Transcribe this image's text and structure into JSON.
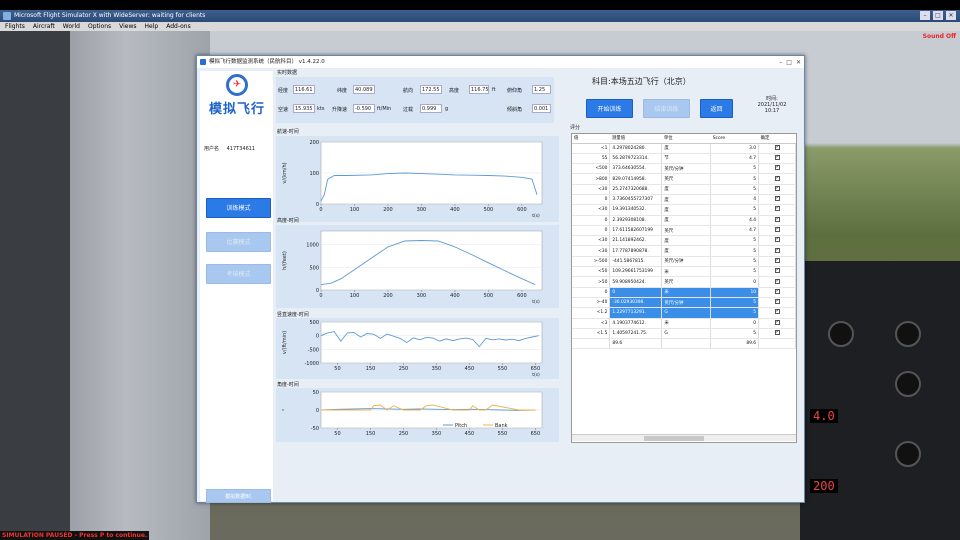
{
  "fsx": {
    "title": "Microsoft Flight Simulator X with WideServer: waiting for clients",
    "menu": [
      "Flights",
      "Aircraft",
      "World",
      "Options",
      "Views",
      "Help",
      "Add-ons"
    ],
    "sound_status": "Sound Off",
    "paused_msg": "SIMULATION PAUSED - Press P to continue.",
    "instruments": {
      "readout_1": "4.0",
      "readout_2": "200"
    }
  },
  "app": {
    "title": "模拟飞行数据监测系统（民航科目） v1.4.22.0",
    "brand": "模拟飞行",
    "user_label": "用户名",
    "user_id": "417T34611",
    "nav": [
      "训练模式",
      "比赛模式",
      "考核模式"
    ],
    "nav_bottom": "模拟数据BC",
    "realtime_label": "实时数据",
    "realtime": [
      {
        "label": "经度",
        "value": "116.61"
      },
      {
        "label": "纬度",
        "value": "40.089"
      },
      {
        "label": "航向",
        "value": "172.55"
      },
      {
        "label": "高度",
        "value": "116.75",
        "unit": "ft"
      },
      {
        "label": "俯仰角",
        "value": "1.25"
      },
      {
        "label": "空速",
        "value": "15.935",
        "unit": "kts"
      },
      {
        "label": "升降速",
        "value": "-0.590",
        "unit": "ft/Min"
      },
      {
        "label": "过载",
        "value": "0.999",
        "unit": "g"
      },
      {
        "label": "倾斜角",
        "value": "0.001"
      }
    ],
    "subject": "科目:本场五边飞行（北京）",
    "buttons": {
      "start": "开始训练",
      "end": "结束训练",
      "back": "返回"
    },
    "time_label": "时间:",
    "time_value": "2021/11/02 10:17",
    "score_label": "评分",
    "table_headers": [
      "值",
      "测量值",
      "单位",
      "Score",
      "确定"
    ],
    "rows": [
      [
        "<1",
        "4.2978024280.",
        "度",
        "3.0"
      ],
      [
        "55",
        "56.2879723314.",
        "节",
        "4.7"
      ],
      [
        "<500",
        "373.64630554.",
        "英尺/分钟",
        "5"
      ],
      [
        ">800",
        "829.07414958.",
        "英尺",
        "5"
      ],
      [
        "<30",
        "25.2747320688.",
        "度",
        "5"
      ],
      [
        "0",
        "3.7360455727307",
        "度",
        "4"
      ],
      [
        "<30",
        "19.391340532.",
        "度",
        "5"
      ],
      [
        "0",
        "2.3929308108.",
        "度",
        "4.4"
      ],
      [
        "0",
        "17.611582607199",
        "英尺",
        "4.7"
      ],
      [
        "<30",
        "21.141892462.",
        "度",
        "5"
      ],
      [
        "<30",
        "17.7787890878.",
        "度",
        "5"
      ],
      [
        ">-500",
        "-441.5867815.",
        "英尺/分钟",
        "5"
      ],
      [
        "<50",
        "109.29661753199",
        "米",
        "5"
      ],
      [
        ">50",
        "59.908950424.",
        "英尺",
        "0"
      ],
      [
        "0",
        "0",
        "米",
        "10"
      ],
      [
        ">-40",
        "-36.02930398.",
        "英尺/分钟",
        "5"
      ],
      [
        "<1.2",
        "1.2297713291.",
        "G",
        "5"
      ],
      [
        "<3",
        "4.1903774612.",
        "米",
        "0"
      ],
      [
        "<1.5",
        "1.40597241.75.",
        "G",
        "5"
      ],
      [
        "",
        "89.6",
        "",
        "89.6"
      ]
    ],
    "selected_rows": [
      14,
      15,
      16
    ],
    "charts": [
      {
        "title": "航速-时间",
        "ylabel": "v/(km/h)",
        "yticks": [
          "200",
          "100",
          "0"
        ],
        "xticks": [
          "0",
          "100",
          "200",
          "300",
          "400",
          "500",
          "600"
        ],
        "xunit": "t(s)"
      },
      {
        "title": "高度-时间",
        "ylabel": "h/(feet)",
        "yticks": [
          "1000",
          "500",
          "0"
        ],
        "xticks": [
          "0",
          "100",
          "200",
          "300",
          "400",
          "500",
          "600"
        ],
        "xunit": "t(s)"
      },
      {
        "title": "竖直速度-时间",
        "ylabel": "v/(ft/min)",
        "yticks": [
          "500",
          "0",
          "-500",
          "-1000"
        ],
        "xticks": [
          "50",
          "150",
          "250",
          "350",
          "450",
          "550",
          "650"
        ],
        "xunit": "t(s)"
      },
      {
        "title": "角度-时间",
        "ylabel": "°",
        "yticks": [
          "50",
          "0",
          "-50"
        ],
        "xticks": [
          "50",
          "150",
          "250",
          "350",
          "450",
          "550",
          "650"
        ],
        "legend": [
          "Pitch",
          "Bank"
        ]
      }
    ]
  },
  "chart_data": [
    {
      "type": "line",
      "title": "航速-时间",
      "ylabel": "v/(km/h)",
      "xlabel": "t(s)",
      "ylim": [
        0,
        200
      ],
      "xlim": [
        0,
        660
      ],
      "x": [
        0,
        10,
        20,
        40,
        80,
        150,
        200,
        250,
        300,
        350,
        400,
        450,
        500,
        550,
        600,
        630,
        645
      ],
      "y": [
        10,
        30,
        80,
        92,
        92,
        94,
        98,
        100,
        98,
        96,
        94,
        93,
        92,
        90,
        86,
        80,
        30
      ]
    },
    {
      "type": "line",
      "title": "高度-时间",
      "ylabel": "h/(feet)",
      "xlabel": "t(s)",
      "ylim": [
        0,
        1300
      ],
      "xlim": [
        0,
        660
      ],
      "x": [
        0,
        30,
        60,
        100,
        150,
        200,
        250,
        300,
        350,
        400,
        450,
        500,
        550,
        600,
        640
      ],
      "y": [
        120,
        150,
        250,
        450,
        700,
        950,
        1080,
        1090,
        1080,
        950,
        780,
        600,
        420,
        250,
        120
      ]
    },
    {
      "type": "line",
      "title": "竖直速度-时间",
      "ylabel": "v/(ft/min)",
      "xlabel": "t(s)",
      "ylim": [
        -1000,
        500
      ],
      "xlim": [
        0,
        670
      ],
      "x": [
        0,
        20,
        40,
        60,
        80,
        100,
        120,
        140,
        160,
        180,
        200,
        220,
        240,
        260,
        280,
        300,
        320,
        340,
        360,
        380,
        400,
        420,
        440,
        460,
        480,
        500,
        520,
        540,
        560,
        580,
        600,
        620,
        640,
        660
      ],
      "y": [
        0,
        100,
        150,
        -200,
        100,
        120,
        -50,
        80,
        50,
        -100,
        60,
        -20,
        -100,
        -250,
        -80,
        -150,
        -60,
        -90,
        -200,
        -120,
        -180,
        -120,
        -90,
        -140,
        -400,
        -100,
        -150,
        -120,
        -160,
        -130,
        -180,
        -100,
        -50,
        0
      ]
    },
    {
      "type": "line",
      "title": "角度-时间",
      "ylim": [
        -50,
        50
      ],
      "xlim": [
        0,
        670
      ],
      "series": [
        {
          "name": "Pitch",
          "x": [
            0,
            50,
            100,
            150,
            200,
            250,
            300,
            350,
            400,
            450,
            500,
            550,
            600,
            650
          ],
          "y": [
            0,
            2,
            3,
            4,
            3,
            2,
            3,
            2,
            1,
            2,
            1,
            0,
            -1,
            0
          ]
        },
        {
          "name": "Bank",
          "x": [
            0,
            100,
            150,
            160,
            180,
            200,
            220,
            250,
            300,
            320,
            340,
            400,
            450,
            460,
            480,
            500,
            520,
            600,
            650
          ],
          "y": [
            0,
            0,
            0,
            12,
            14,
            0,
            12,
            0,
            0,
            12,
            14,
            0,
            0,
            12,
            0,
            0,
            14,
            0,
            0
          ]
        }
      ]
    }
  ]
}
